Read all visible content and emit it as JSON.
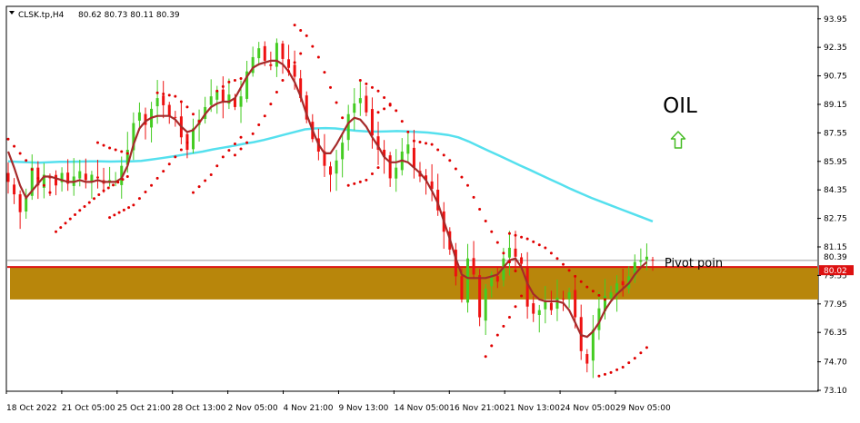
{
  "header": {
    "symbol": "CLSK.tp,H4",
    "ohlc": "80.62 80.73 80.11 80.39"
  },
  "chart_data": {
    "type": "candlestick",
    "title": "OIL",
    "ylim": [
      73.1,
      94.6
    ],
    "y_ticks": [
      "93.95",
      "92.35",
      "90.75",
      "89.15",
      "87.55",
      "85.95",
      "84.35",
      "82.75",
      "81.15",
      "79.55",
      "77.95",
      "76.35",
      "74.70",
      "73.10"
    ],
    "x_ticks": [
      "18 Oct 2022",
      "21 Oct 05:00",
      "25 Oct 21:00",
      "28 Oct 13:00",
      "2 Nov 05:00",
      "4 Nov 21:00",
      "9 Nov 13:00",
      "14 Nov 05:00",
      "16 Nov 21:00",
      "21 Nov 13:00",
      "24 Nov 05:00",
      "29 Nov 05:00"
    ],
    "current_price": "80.39",
    "pivot_price": "80.02",
    "pivot_label": "Pivot poin",
    "support_zone": [
      78.2,
      80.0
    ],
    "close_path": [
      84.8,
      84.1,
      83.1,
      83.9,
      85.6,
      84.6,
      85.2,
      85.0,
      84.6,
      85.3,
      84.7,
      85.1,
      85.4,
      84.9,
      85.2,
      85.0,
      84.7,
      84.9,
      84.8,
      85.7,
      86.6,
      88.1,
      88.7,
      88.0,
      88.9,
      89.5,
      89.1,
      88.5,
      88.4,
      87.3,
      86.6,
      87.8,
      88.3,
      89.0,
      89.6,
      89.9,
      89.3,
      89.7,
      89.0,
      89.6,
      91.0,
      91.8,
      92.3,
      91.6,
      91.3,
      92.6,
      91.7,
      91.2,
      90.7,
      89.5,
      88.3,
      87.2,
      86.5,
      85.7,
      85.2,
      86.0,
      87.0,
      88.6,
      89.2,
      89.5,
      88.7,
      87.4,
      86.6,
      86.2,
      85.0,
      85.6,
      86.5,
      86.9,
      85.6,
      85.1,
      84.9,
      84.4,
      83.2,
      82.0,
      81.0,
      79.5,
      78.2,
      80.5,
      79.6,
      77.2,
      78.8,
      79.6,
      79.2,
      80.5,
      81.1,
      80.6,
      80.2,
      77.8,
      77.4,
      77.6,
      78.1,
      77.6,
      78.3,
      78.2,
      78.6,
      77.2,
      75.3,
      74.6,
      76.5,
      77.7,
      78.4,
      78.6,
      79.1,
      79.0,
      79.5,
      80.3,
      80.4,
      80.6,
      80.4
    ],
    "sma_fast": [
      86.5,
      85.6,
      84.6,
      83.9,
      84.3,
      84.7,
      85.1,
      85.1,
      85.0,
      84.9,
      84.8,
      84.8,
      84.9,
      84.8,
      84.8,
      84.9,
      84.8,
      84.8,
      84.8,
      85.0,
      85.7,
      86.9,
      87.8,
      88.2,
      88.4,
      88.5,
      88.5,
      88.5,
      88.3,
      87.9,
      87.6,
      87.7,
      88.1,
      88.6,
      89.0,
      89.2,
      89.3,
      89.3,
      89.5,
      90.1,
      90.7,
      91.2,
      91.4,
      91.5,
      91.6,
      91.6,
      91.4,
      91.0,
      90.4,
      89.6,
      88.6,
      87.7,
      86.9,
      86.4,
      86.4,
      86.9,
      87.5,
      88.1,
      88.4,
      88.3,
      87.9,
      87.3,
      86.8,
      86.2,
      85.9,
      85.9,
      86.0,
      85.9,
      85.6,
      85.3,
      84.9,
      84.3,
      83.6,
      82.6,
      81.6,
      80.5,
      79.6,
      79.4,
      79.4,
      79.4,
      79.4,
      79.5,
      79.6,
      80.0,
      80.4,
      80.5,
      80.0,
      79.1,
      78.5,
      78.2,
      78.1,
      78.1,
      78.1,
      78.0,
      77.6,
      76.9,
      76.2,
      76.1,
      76.4,
      76.9,
      77.6,
      78.1,
      78.5,
      78.8,
      79.1,
      79.6,
      80.0,
      80.3
    ],
    "sma_slow": [
      85.95,
      85.92,
      85.9,
      85.88,
      85.9,
      85.93,
      85.93,
      85.94,
      85.95,
      85.95,
      85.94,
      85.95,
      85.95,
      85.98,
      86.05,
      86.13,
      86.22,
      86.31,
      86.41,
      86.5,
      86.62,
      86.72,
      86.82,
      86.93,
      87.03,
      87.15,
      87.3,
      87.45,
      87.6,
      87.75,
      87.8,
      87.82,
      87.8,
      87.73,
      87.67,
      87.63,
      87.62,
      87.63,
      87.65,
      87.63,
      87.6,
      87.57,
      87.51,
      87.43,
      87.3,
      87.07,
      86.8,
      86.53,
      86.27,
      86.0,
      85.73,
      85.47,
      85.2,
      84.93,
      84.67,
      84.4,
      84.15,
      83.9,
      83.68,
      83.46,
      83.24,
      83.02,
      82.8,
      82.58
    ],
    "psar_segments": [
      [
        {
          "i": 0,
          "v": 87.2
        },
        {
          "i": 3,
          "v": 86.0
        },
        {
          "i": 5,
          "v": 85.0
        },
        {
          "i": 7,
          "v": 84.2
        }
      ],
      [
        {
          "i": 8,
          "v": 82.0
        },
        {
          "i": 12,
          "v": 83.2
        },
        {
          "i": 16,
          "v": 84.3
        },
        {
          "i": 20,
          "v": 85.1
        }
      ],
      [
        {
          "i": 15,
          "v": 87.0
        },
        {
          "i": 17,
          "v": 86.7
        },
        {
          "i": 20,
          "v": 86.4
        }
      ],
      [
        {
          "i": 17,
          "v": 82.8
        },
        {
          "i": 21,
          "v": 83.5
        },
        {
          "i": 24,
          "v": 84.6
        },
        {
          "i": 27,
          "v": 85.8
        },
        {
          "i": 30,
          "v": 87.0
        }
      ],
      [
        {
          "i": 25,
          "v": 89.8
        },
        {
          "i": 28,
          "v": 89.6
        },
        {
          "i": 30,
          "v": 89.0
        },
        {
          "i": 32,
          "v": 88.2
        }
      ],
      [
        {
          "i": 31,
          "v": 84.2
        },
        {
          "i": 34,
          "v": 85.2
        },
        {
          "i": 36,
          "v": 86.2
        },
        {
          "i": 39,
          "v": 87.3
        }
      ],
      [
        {
          "i": 35,
          "v": 89.9
        },
        {
          "i": 37,
          "v": 90.4
        },
        {
          "i": 39,
          "v": 90.6
        }
      ],
      [
        {
          "i": 38,
          "v": 86.3
        },
        {
          "i": 40,
          "v": 87.0
        },
        {
          "i": 43,
          "v": 88.5
        },
        {
          "i": 46,
          "v": 90.5
        },
        {
          "i": 49,
          "v": 92.0
        }
      ],
      [
        {
          "i": 48,
          "v": 93.6
        },
        {
          "i": 50,
          "v": 93.0
        },
        {
          "i": 52,
          "v": 91.8
        },
        {
          "i": 54,
          "v": 90.1
        },
        {
          "i": 56,
          "v": 88.4
        }
      ],
      [
        {
          "i": 57,
          "v": 84.6
        },
        {
          "i": 60,
          "v": 84.9
        },
        {
          "i": 62,
          "v": 85.6
        }
      ],
      [
        {
          "i": 62,
          "v": 88.7
        },
        {
          "i": 64,
          "v": 89.1
        }
      ],
      [
        {
          "i": 59,
          "v": 90.5
        },
        {
          "i": 62,
          "v": 89.9
        },
        {
          "i": 65,
          "v": 88.8
        },
        {
          "i": 67,
          "v": 87.6
        }
      ],
      [
        {
          "i": 68,
          "v": 87.1
        },
        {
          "i": 71,
          "v": 86.9
        },
        {
          "i": 74,
          "v": 86.0
        },
        {
          "i": 77,
          "v": 84.6
        },
        {
          "i": 80,
          "v": 82.6
        },
        {
          "i": 83,
          "v": 80.8
        },
        {
          "i": 85,
          "v": 79.8
        }
      ],
      [
        {
          "i": 80,
          "v": 75.0
        },
        {
          "i": 82,
          "v": 76.2
        },
        {
          "i": 84,
          "v": 77.2
        },
        {
          "i": 86,
          "v": 78.4
        }
      ],
      [
        {
          "i": 84,
          "v": 81.9
        },
        {
          "i": 87,
          "v": 81.6
        },
        {
          "i": 90,
          "v": 81.1
        },
        {
          "i": 92,
          "v": 80.5
        },
        {
          "i": 95,
          "v": 79.5
        },
        {
          "i": 97,
          "v": 78.9
        },
        {
          "i": 100,
          "v": 78.2
        }
      ],
      [
        {
          "i": 99,
          "v": 73.9
        },
        {
          "i": 101,
          "v": 74.1
        },
        {
          "i": 103,
          "v": 74.4
        },
        {
          "i": 105,
          "v": 74.9
        },
        {
          "i": 107,
          "v": 75.5
        }
      ]
    ],
    "trend_arrow": "up",
    "colors": {
      "bull": "#44cc22",
      "bear": "#ee1111",
      "sma_fast": "#a52a2a",
      "sma_slow": "#55e0ee",
      "psar": "#e00000",
      "zone": "#b8860b",
      "pivot_line": "#dd1111",
      "current_line": "#9a9a9a",
      "arrow": "#44bb22"
    }
  }
}
